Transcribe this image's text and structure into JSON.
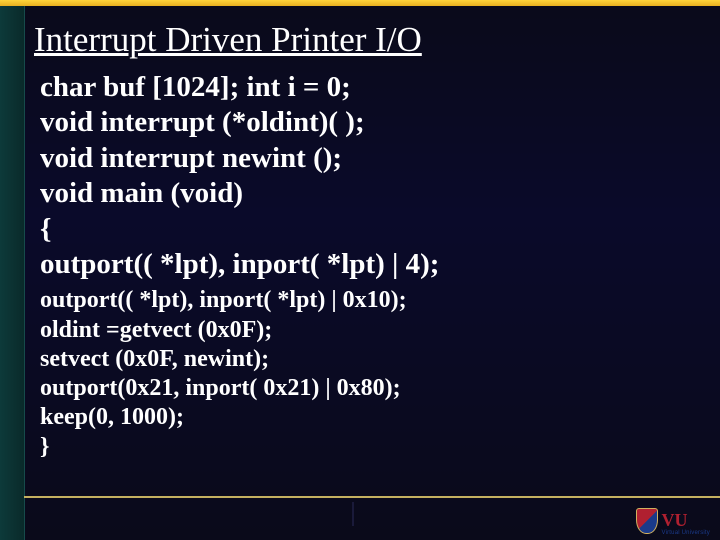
{
  "slide": {
    "title": "Interrupt Driven Printer I/O",
    "code_block1": [
      "char buf [1024]; int i = 0;",
      "void interrupt (*oldint)( );",
      "void interrupt newint ();",
      "void main (void)",
      "{",
      "outport(( *lpt), inport( *lpt) | 4);"
    ],
    "code_block2": [
      "outport(( *lpt), inport( *lpt) | 0x10);",
      "oldint =getvect (0x0F);",
      "setvect (0x0F, newint);",
      "outport(0x21, inport( 0x21) | 0x80);",
      "keep(0, 1000);",
      "}"
    ]
  },
  "logo": {
    "initials": "VU",
    "subtitle": "Virtual University"
  }
}
